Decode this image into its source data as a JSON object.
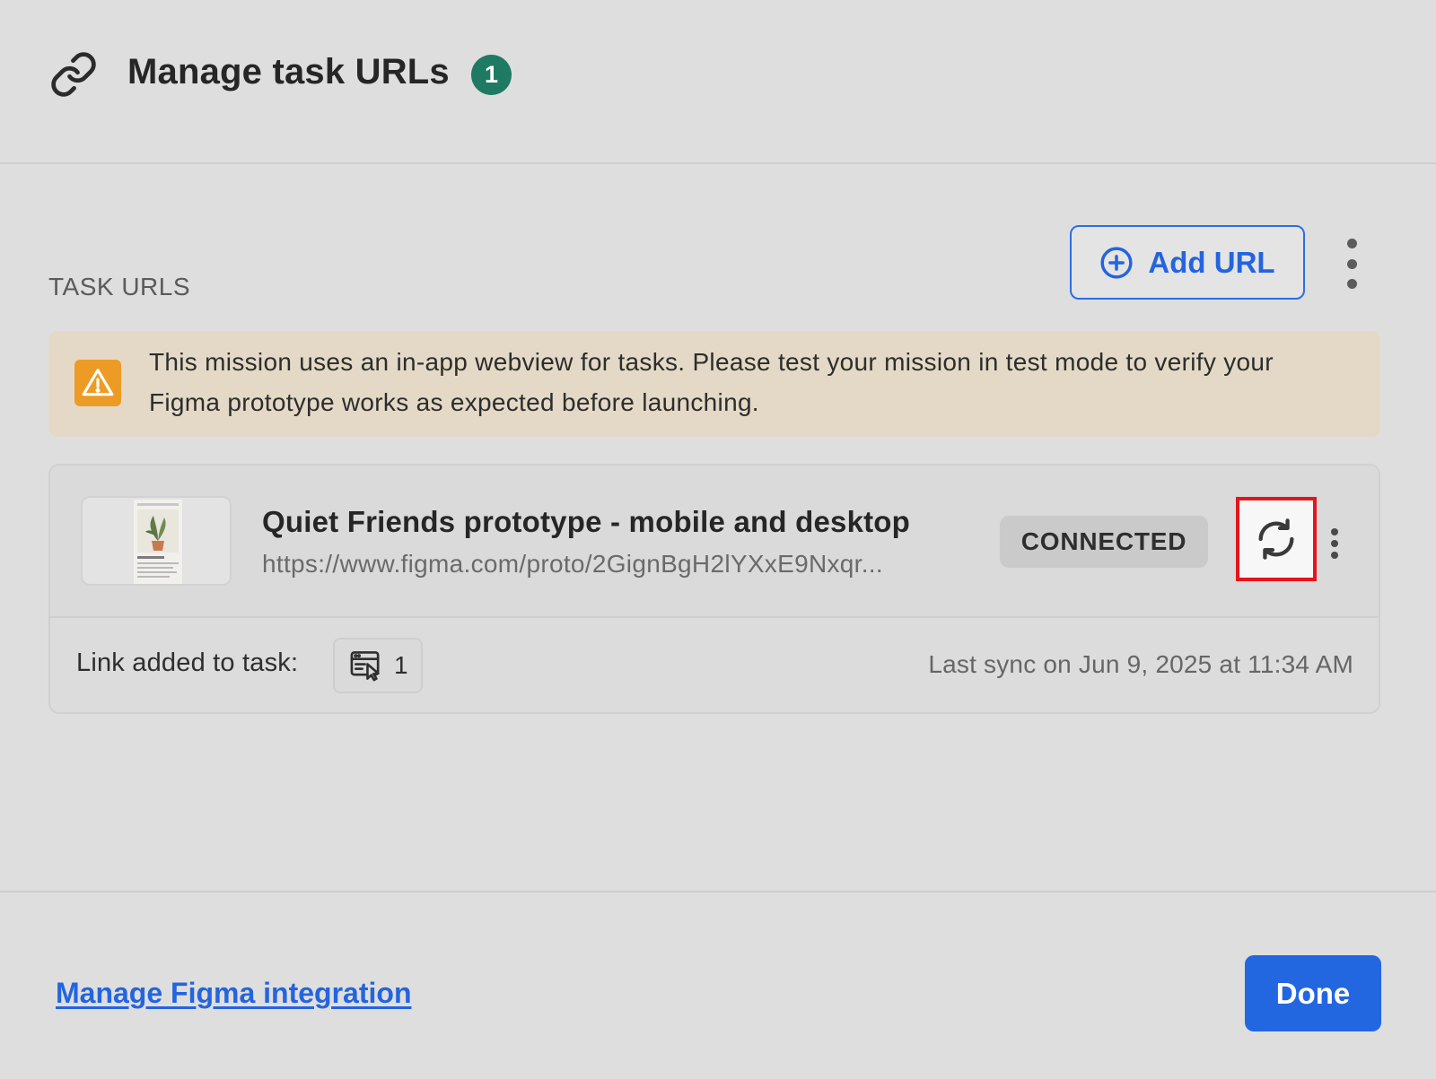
{
  "header": {
    "title": "Manage task URLs",
    "count": "1",
    "icon": "link-icon"
  },
  "task_urls": {
    "section_label": "TASK URLS",
    "add_url_label": "Add URL",
    "warning": {
      "icon": "warning-icon",
      "text": "This mission uses an in-app webview for tasks. Please test your mission in test mode to verify your Figma prototype works as expected before launching."
    },
    "items": [
      {
        "name": "Quiet Friends prototype - mobile and desktop",
        "url": "https://www.figma.com/proto/2GignBgH2lYXxE9Nxqr...",
        "status": "CONNECTED",
        "link_label": "Link added to task:",
        "task_count": "1",
        "last_sync": "Last sync on Jun 9, 2025 at 11:34 AM"
      }
    ]
  },
  "footer": {
    "manage_link": "Manage Figma integration",
    "done_label": "Done"
  },
  "colors": {
    "accent": "#2367e0",
    "badge": "#1f7a63",
    "warning_bg": "#e4d9c6",
    "warning_icon": "#ec9c25",
    "highlight": "#e6141c"
  }
}
